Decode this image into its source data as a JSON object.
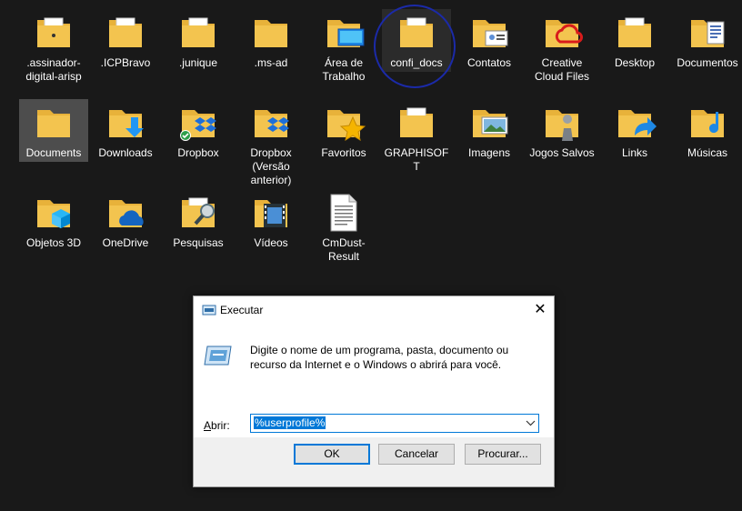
{
  "desktop": {
    "items": [
      {
        "label": ".assinador-digital-arisp",
        "icon": "folder-document-icon"
      },
      {
        "label": ".ICPBravo",
        "icon": "folder-icon"
      },
      {
        "label": ".junique",
        "icon": "folder-icon"
      },
      {
        "label": ".ms-ad",
        "icon": "folder-icon"
      },
      {
        "label": "Área de Trabalho",
        "icon": "desktop-folder-icon"
      },
      {
        "label": "confi_docs",
        "icon": "folder-icon"
      },
      {
        "label": "Contatos",
        "icon": "contacts-folder-icon"
      },
      {
        "label": "Creative Cloud Files",
        "icon": "creative-cloud-folder-icon"
      },
      {
        "label": "Desktop",
        "icon": "folder-icon"
      },
      {
        "label": "Documentos",
        "icon": "documents-folder-icon"
      },
      {
        "label": "Documents",
        "icon": "folder-icon"
      },
      {
        "label": "Downloads",
        "icon": "downloads-folder-icon"
      },
      {
        "label": "Dropbox",
        "icon": "dropbox-folder-icon"
      },
      {
        "label": "Dropbox (Versão anterior)",
        "icon": "dropbox-folder-icon"
      },
      {
        "label": "Favoritos",
        "icon": "favorites-folder-icon"
      },
      {
        "label": "GRAPHISOFT",
        "icon": "folder-icon"
      },
      {
        "label": "Imagens",
        "icon": "pictures-folder-icon"
      },
      {
        "label": "Jogos Salvos",
        "icon": "saved-games-folder-icon"
      },
      {
        "label": "Links",
        "icon": "links-folder-icon"
      },
      {
        "label": "Músicas",
        "icon": "music-folder-icon"
      },
      {
        "label": "Objetos 3D",
        "icon": "3d-objects-folder-icon"
      },
      {
        "label": "OneDrive",
        "icon": "onedrive-folder-icon"
      },
      {
        "label": "Pesquisas",
        "icon": "searches-folder-icon"
      },
      {
        "label": "Vídeos",
        "icon": "videos-folder-icon"
      },
      {
        "label": "CmDust-Result",
        "icon": "text-file-icon"
      }
    ]
  },
  "dialog": {
    "title": "Executar",
    "description": "Digite o nome de um programa, pasta, documento ou recurso da Internet e o Windows o abrirá para você.",
    "open_label": "Abrir:",
    "open_value": "%userprofile%",
    "ok_label": "OK",
    "cancel_label": "Cancelar",
    "browse_label": "Procurar..."
  },
  "colors": {
    "background": "#191919",
    "folder": "#f3c44f",
    "accent": "#0078d7",
    "annotation": "#1b2aa8"
  }
}
